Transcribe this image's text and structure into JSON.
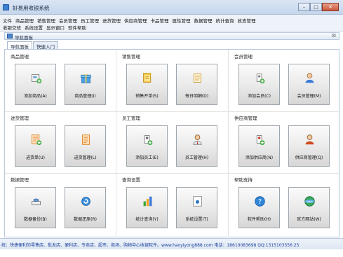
{
  "window": {
    "title": "好易用收银系统",
    "icon": "app-icon",
    "controls": [
      "minimize",
      "maximize",
      "close"
    ]
  },
  "menu": {
    "row1": [
      "文件",
      "商品管理",
      "销售管理",
      "会员管理",
      "员工管理",
      "进货管理",
      "供应商管理",
      "卡品管理",
      "属性管理",
      "数据管理",
      "统计查询",
      "收支管理"
    ],
    "row2": [
      "收银交班",
      "系统设置",
      "显示窗口",
      "软件帮助"
    ]
  },
  "panel": {
    "title": "导航面板",
    "close": "☒"
  },
  "tabs": [
    "导航面板",
    "快速入门"
  ],
  "groups": [
    {
      "title": "商品管理",
      "tiles": [
        {
          "label": "添加商品(A)",
          "icon": "add-product-icon"
        },
        {
          "label": "商品管理(I)",
          "icon": "product-gift-icon"
        }
      ]
    },
    {
      "title": "销售管理",
      "tiles": [
        {
          "label": "销售开单(S)",
          "icon": "sales-bill-icon"
        },
        {
          "label": "每日明细(D)",
          "icon": "daily-detail-icon"
        }
      ]
    },
    {
      "title": "会员管理",
      "tiles": [
        {
          "label": "添加会员(C)",
          "icon": "add-member-icon"
        },
        {
          "label": "会员管理(M)",
          "icon": "member-icon"
        }
      ]
    },
    {
      "title": "进货管理",
      "tiles": [
        {
          "label": "进货单(U)",
          "icon": "purchase-add-icon"
        },
        {
          "label": "进货管理(L)",
          "icon": "purchase-doc-icon"
        }
      ]
    },
    {
      "title": "员工管理",
      "tiles": [
        {
          "label": "添加员工(E)",
          "icon": "add-employee-icon"
        },
        {
          "label": "员工管理(H)",
          "icon": "employee-icon"
        }
      ]
    },
    {
      "title": "供应商管理",
      "tiles": [
        {
          "label": "添加供应商(N)",
          "icon": "add-supplier-icon"
        },
        {
          "label": "供应商管理(Q)",
          "icon": "supplier-icon"
        }
      ]
    },
    {
      "title": "数据管理",
      "tiles": [
        {
          "label": "数据备份(B)",
          "icon": "backup-icon"
        },
        {
          "label": "数据还原(R)",
          "icon": "restore-icon"
        }
      ]
    },
    {
      "title": "查询设置",
      "tiles": [
        {
          "label": "统计查询(Y)",
          "icon": "stats-chart-icon"
        },
        {
          "label": "系统设置(T)",
          "icon": "settings-icon"
        }
      ]
    },
    {
      "title": "帮助支持",
      "tiles": [
        {
          "label": "软件帮助(H)",
          "icon": "help-icon"
        },
        {
          "label": "官方网站(W)",
          "icon": "website-icon"
        }
      ]
    }
  ],
  "status": {
    "text": "统：快捷便利的零售店、批发店、便利店、专卖店、超市、商场、购物中心收银软件。www.haoyiyong888.com 电话：18610083698  QQ:1315103556 25"
  },
  "colors": {
    "titlebar": "#c5d6ec",
    "status_text": "#1a3f9c",
    "tile_border": "#9ea6ad"
  }
}
